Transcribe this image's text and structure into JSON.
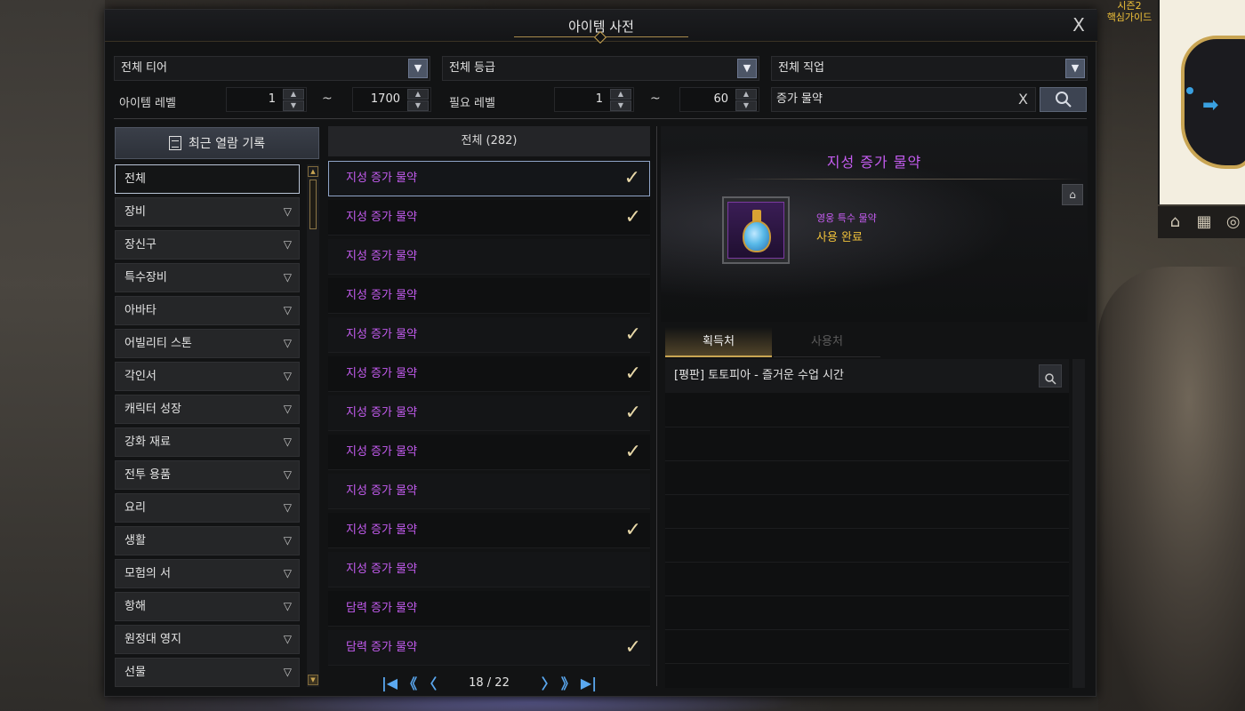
{
  "window": {
    "title": "아이템 사전",
    "close_label": "X"
  },
  "filters": {
    "tier": "전체 티어",
    "grade": "전체 등급",
    "job": "전체 직업",
    "item_level_label": "아이템 레벨",
    "item_level_min": "1",
    "item_level_max": "1700",
    "req_level_label": "필요 레벨",
    "req_level_min": "1",
    "req_level_max": "60",
    "tilde": "~",
    "search_value": "증가 물약",
    "search_clear": "X"
  },
  "sidebar": {
    "recent_label": "최근 열람 기록",
    "categories": [
      {
        "label": "전체"
      },
      {
        "label": "장비"
      },
      {
        "label": "장신구"
      },
      {
        "label": "특수장비"
      },
      {
        "label": "아바타"
      },
      {
        "label": "어빌리티 스톤"
      },
      {
        "label": "각인서"
      },
      {
        "label": "캐릭터 성장"
      },
      {
        "label": "강화 재료"
      },
      {
        "label": "전투 용품"
      },
      {
        "label": "요리"
      },
      {
        "label": "생활"
      },
      {
        "label": "모험의 서"
      },
      {
        "label": "항해"
      },
      {
        "label": "원정대 영지"
      },
      {
        "label": "선물"
      }
    ]
  },
  "list": {
    "header": "전체 (282)",
    "items": [
      {
        "name": "지성 증가 물약",
        "checked": true
      },
      {
        "name": "지성 증가 물약",
        "checked": true
      },
      {
        "name": "지성 증가 물약",
        "checked": false
      },
      {
        "name": "지성 증가 물약",
        "checked": false
      },
      {
        "name": "지성 증가 물약",
        "checked": true
      },
      {
        "name": "지성 증가 물약",
        "checked": true
      },
      {
        "name": "지성 증가 물약",
        "checked": true
      },
      {
        "name": "지성 증가 물약",
        "checked": true
      },
      {
        "name": "지성 증가 물약",
        "checked": false
      },
      {
        "name": "지성 증가 물약",
        "checked": true
      },
      {
        "name": "지성 증가 물약",
        "checked": false
      },
      {
        "name": "담력 증가 물약",
        "checked": false
      },
      {
        "name": "담력 증가 물약",
        "checked": true
      }
    ],
    "check_glyph": "✓",
    "pager": {
      "current": 18,
      "total": 22,
      "text": "18 / 22"
    }
  },
  "detail": {
    "name": "지성 증가 물약",
    "grade": "영웅 특수 물약",
    "status": "사용 완료",
    "tabs": [
      {
        "label": "획득처"
      },
      {
        "label": "사용처"
      }
    ],
    "sources": [
      {
        "label": "[평판] 토토피아 - 즐거운 수업 시간"
      }
    ]
  },
  "hud": {
    "guide_label_line1": "시즌2",
    "guide_label_line2": "핵심가이드"
  },
  "colors": {
    "item_purple": "#c45cf0",
    "gold": "#f0c23a",
    "pager_blue": "#5aa8f0",
    "check": "#e8d8a8"
  },
  "icons": {
    "close": "close-icon",
    "dropdown": "chevron-down-icon",
    "search": "search-icon",
    "recent": "document-icon",
    "check": "checkmark-icon",
    "home": "home-icon"
  }
}
